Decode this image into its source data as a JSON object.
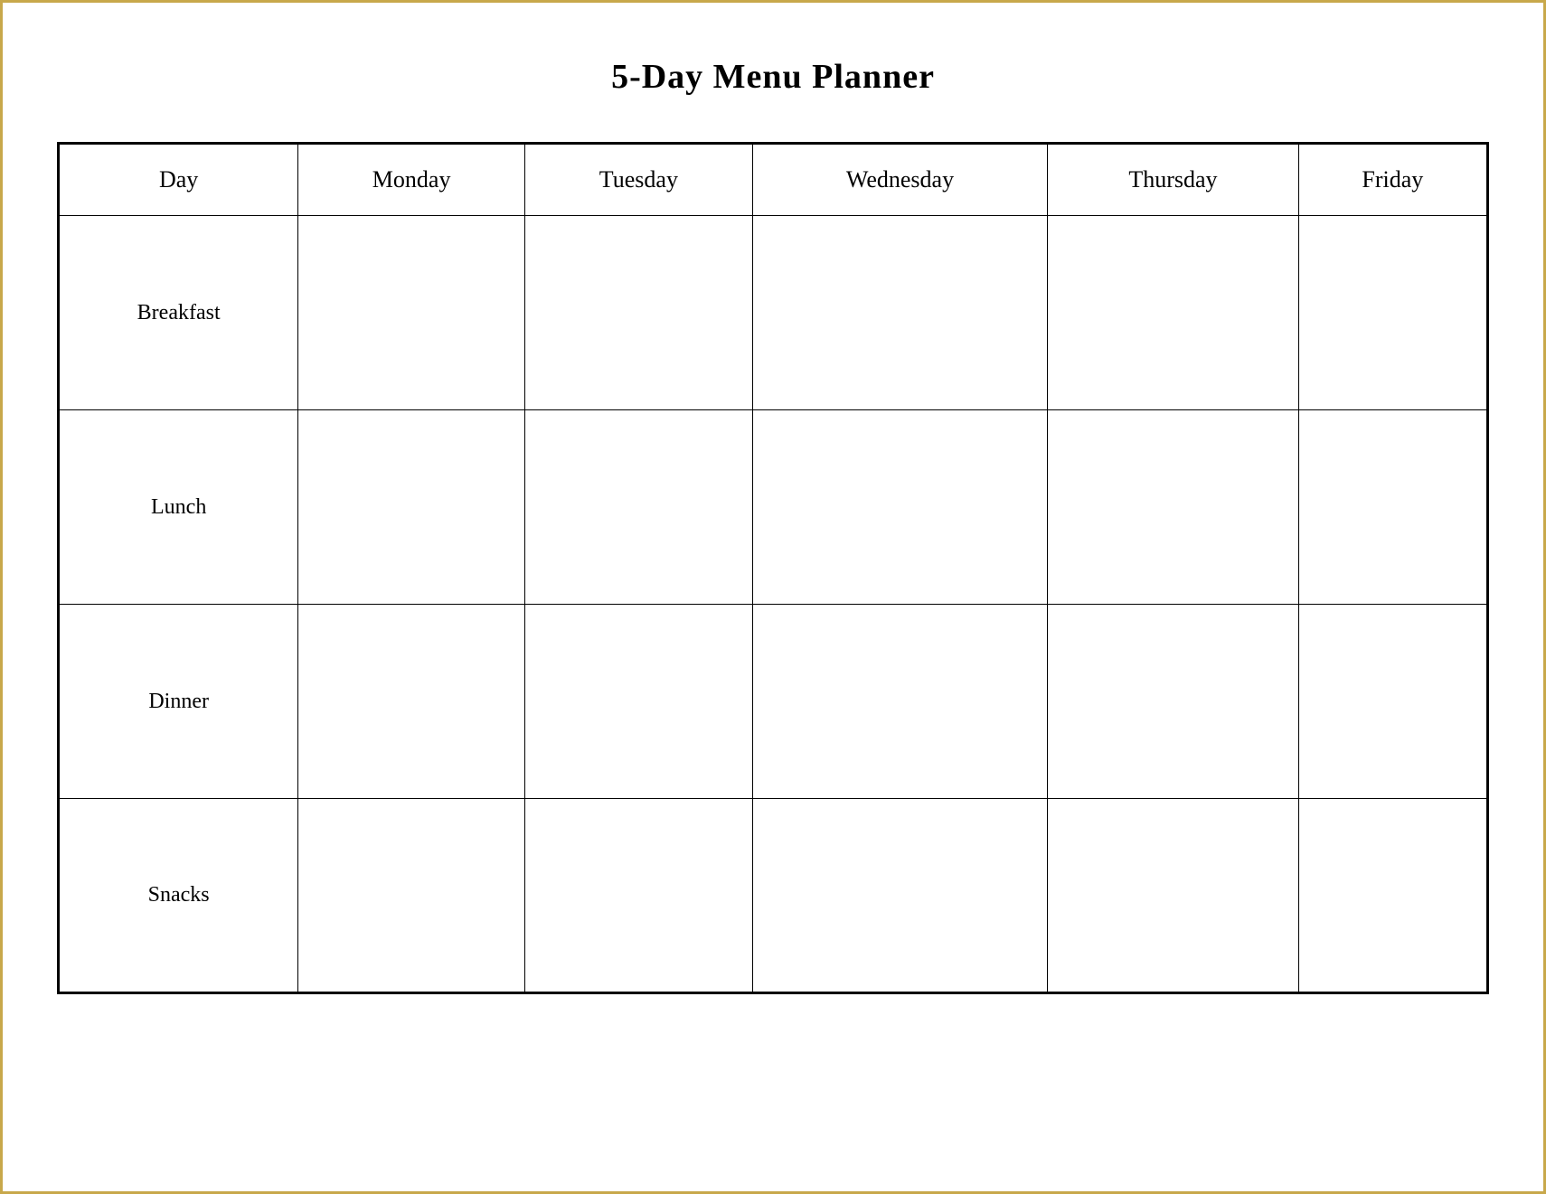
{
  "title": "5-Day Menu Planner",
  "table": {
    "headers": [
      {
        "id": "day",
        "label": "Day"
      },
      {
        "id": "monday",
        "label": "Monday"
      },
      {
        "id": "tuesday",
        "label": "Tuesday"
      },
      {
        "id": "wednesday",
        "label": "Wednesday"
      },
      {
        "id": "thursday",
        "label": "Thursday"
      },
      {
        "id": "friday",
        "label": "Friday"
      }
    ],
    "rows": [
      {
        "meal": "Breakfast"
      },
      {
        "meal": "Lunch"
      },
      {
        "meal": "Dinner"
      },
      {
        "meal": "Snacks"
      }
    ]
  }
}
